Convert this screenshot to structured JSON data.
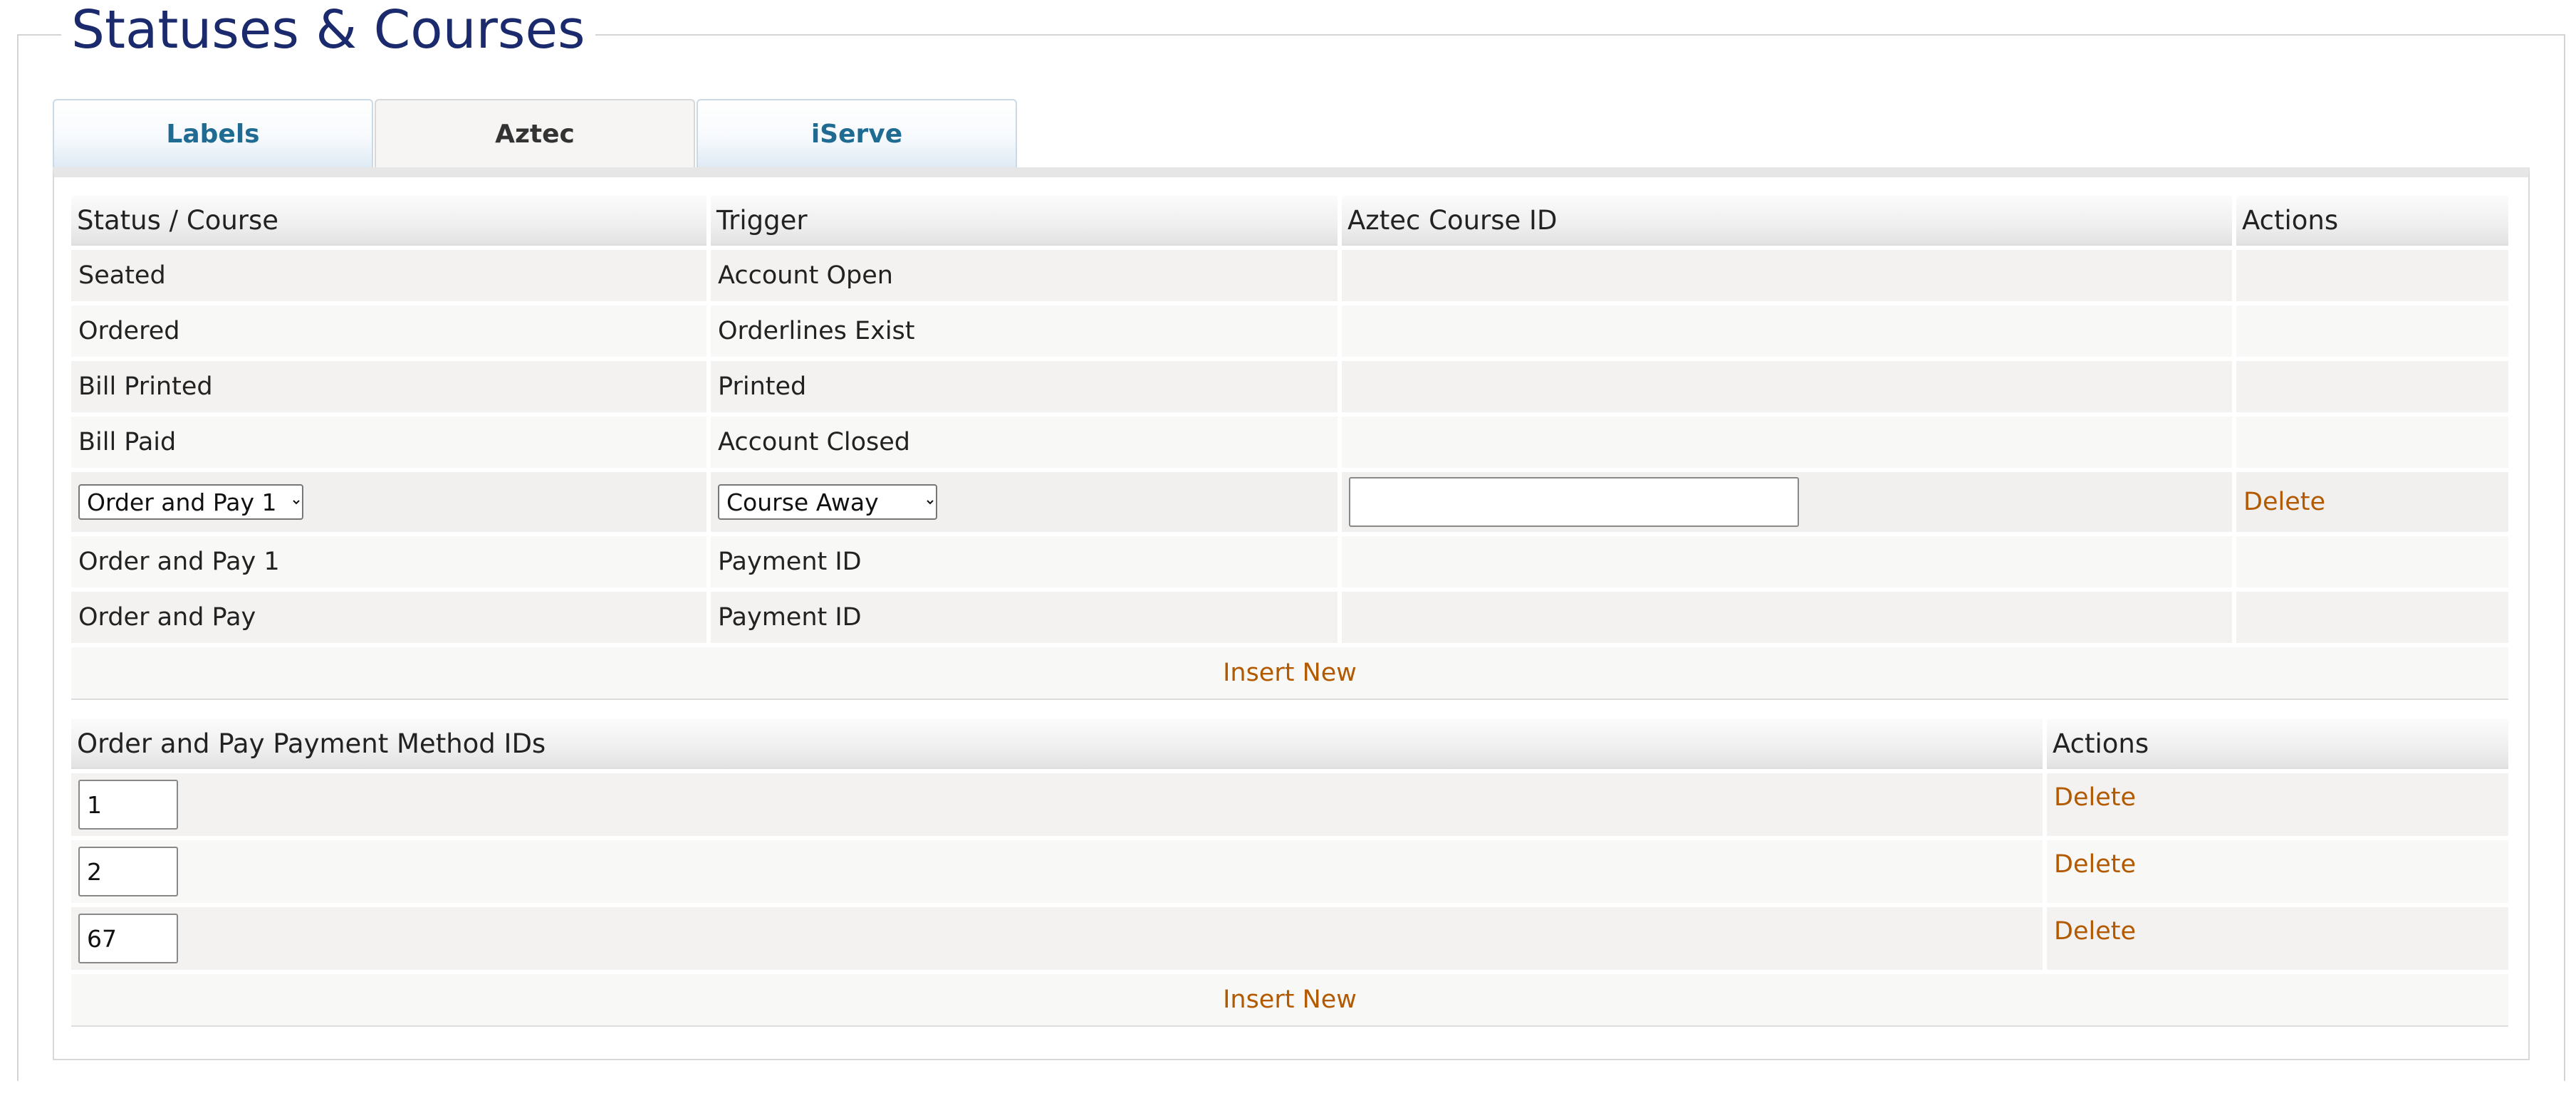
{
  "page": {
    "title": "Statuses & Courses"
  },
  "tabs": [
    {
      "label": "Labels",
      "active": false
    },
    {
      "label": "Aztec",
      "active": true
    },
    {
      "label": "iServe",
      "active": false
    }
  ],
  "status_table": {
    "headers": {
      "status": "Status / Course",
      "trigger": "Trigger",
      "course_id": "Aztec Course ID",
      "actions": "Actions"
    },
    "rows": [
      {
        "status": "Seated",
        "trigger": "Account Open"
      },
      {
        "status": "Ordered",
        "trigger": "Orderlines Exist"
      },
      {
        "status": "Bill Printed",
        "trigger": "Printed"
      },
      {
        "status": "Bill Paid",
        "trigger": "Account Closed"
      }
    ],
    "edit_row": {
      "status_selected": "Order and Pay 1",
      "trigger_selected": "Course Away",
      "course_id_value": "",
      "delete_label": "Delete"
    },
    "rows_after": [
      {
        "status": "Order and Pay 1",
        "trigger": "Payment ID"
      },
      {
        "status": "Order and Pay",
        "trigger": "Payment ID"
      }
    ],
    "insert_label": "Insert New"
  },
  "payment_table": {
    "headers": {
      "method": "Order and Pay Payment Method IDs",
      "actions": "Actions"
    },
    "rows": [
      {
        "value": "1",
        "delete_label": "Delete"
      },
      {
        "value": "2",
        "delete_label": "Delete"
      },
      {
        "value": "67",
        "delete_label": "Delete"
      }
    ],
    "insert_label": "Insert New"
  },
  "colors": {
    "title": "#1a2a6c",
    "tab_text": "#1f6b91",
    "link": "#b35a00"
  }
}
